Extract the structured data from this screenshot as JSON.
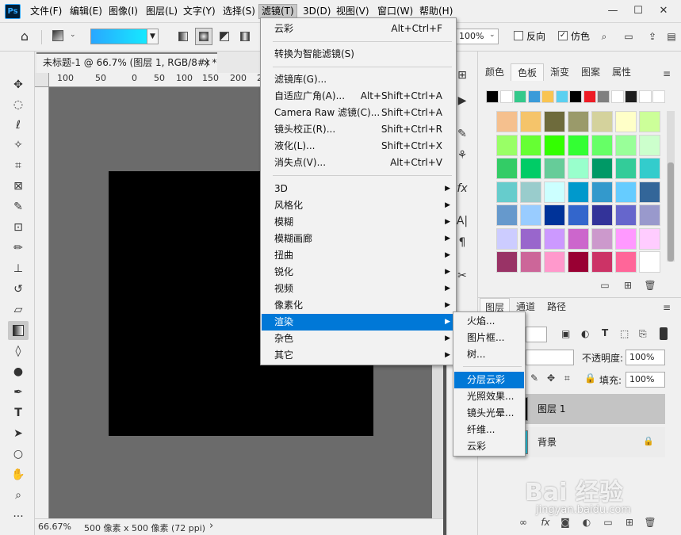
{
  "app": {
    "logo_text": "Ps",
    "menus": [
      "文件(F)",
      "编辑(E)",
      "图像(I)",
      "图层(L)",
      "文字(Y)",
      "选择(S)",
      "滤镜(T)",
      "3D(D)",
      "视图(V)",
      "窗口(W)",
      "帮助(H)"
    ],
    "window_controls": {
      "minimize": "—",
      "maximize": "☐",
      "close": "✕"
    }
  },
  "options_bar": {
    "opacity_value": "100%",
    "reverse_label": "反向",
    "reverse_checked": false,
    "dither_label": "仿色",
    "dither_checked": true,
    "gradient_colors": [
      "#29a7ff",
      "#16e9ff"
    ]
  },
  "document": {
    "tab_title": "未标题-1 @ 66.7% (图层 1, RGB/8#) *",
    "tab_close": "×",
    "ruler_ticks": [
      "100",
      "50",
      "0",
      "50",
      "100",
      "150",
      "200",
      "250"
    ],
    "zoom": "66.67%",
    "status_info": "500 像素 x 500 像素 (72 ppi)",
    "status_arrow": "›"
  },
  "filter_menu": {
    "items": [
      {
        "label": "云彩",
        "shortcut": "Alt+Ctrl+F"
      },
      {
        "label": "转换为智能滤镜(S)",
        "shortcut": ""
      },
      {
        "label": "滤镜库(G)...",
        "shortcut": ""
      },
      {
        "label": "自适应广角(A)...",
        "shortcut": "Alt+Shift+Ctrl+A"
      },
      {
        "label": "Camera Raw 滤镜(C)...",
        "shortcut": "Shift+Ctrl+A"
      },
      {
        "label": "镜头校正(R)...",
        "shortcut": "Shift+Ctrl+R"
      },
      {
        "label": "液化(L)...",
        "shortcut": "Shift+Ctrl+X"
      },
      {
        "label": "消失点(V)...",
        "shortcut": "Alt+Ctrl+V"
      },
      {
        "label": "3D",
        "shortcut": ""
      },
      {
        "label": "风格化",
        "shortcut": ""
      },
      {
        "label": "模糊",
        "shortcut": ""
      },
      {
        "label": "模糊画廊",
        "shortcut": ""
      },
      {
        "label": "扭曲",
        "shortcut": ""
      },
      {
        "label": "锐化",
        "shortcut": ""
      },
      {
        "label": "视频",
        "shortcut": ""
      },
      {
        "label": "像素化",
        "shortcut": ""
      },
      {
        "label": "渲染",
        "shortcut": ""
      },
      {
        "label": "杂色",
        "shortcut": ""
      },
      {
        "label": "其它",
        "shortcut": ""
      }
    ],
    "submenu_arrow": "▶"
  },
  "render_submenu": {
    "items": [
      "火焰...",
      "图片框...",
      "树...",
      "分层云彩",
      "光照效果...",
      "镜头光晕...",
      "纤维...",
      "云彩"
    ]
  },
  "swatches_panel": {
    "tabs": [
      "颜色",
      "色板",
      "渐变",
      "图案",
      "属性"
    ],
    "top_colors": [
      "#000000",
      "#ffffff",
      "#34c98b",
      "#3a9bd9",
      "#f9c452",
      "#5bd0f0",
      "#000000",
      "#ee1c25",
      "#808080",
      "#ffffff",
      "#1e1e1e",
      "#ffffff",
      "#ffffff"
    ],
    "grid_colors": [
      [
        "#f5c08e",
        "#f5c46a",
        "#6e6b3c",
        "#9a9a6a",
        "#d4d29c",
        "#ffffc8",
        "#ccff99"
      ],
      [
        "#99ff66",
        "#66ff33",
        "#33ff00",
        "#33ff33",
        "#66ff66",
        "#99ff99",
        "#ccffcc"
      ],
      [
        "#33cc66",
        "#00cc66",
        "#66cc99",
        "#99ffcc",
        "#009966",
        "#33cc99",
        "#33cccc"
      ],
      [
        "#66cccc",
        "#99cccc",
        "#ccffff",
        "#0099cc",
        "#3399cc",
        "#66ccff",
        "#336699"
      ],
      [
        "#6699cc",
        "#99ccff",
        "#003399",
        "#3366cc",
        "#333399",
        "#6666cc",
        "#9999cc"
      ],
      [
        "#ccccff",
        "#9966cc",
        "#cc99ff",
        "#cc66cc",
        "#cc99cc",
        "#ff99ff",
        "#ffccff"
      ],
      [
        "#993366",
        "#cc6699",
        "#ff99cc",
        "#990033",
        "#cc3366",
        "#ff6699",
        "#ffffff"
      ]
    ]
  },
  "layers_panel": {
    "tabs": [
      "图层",
      "通道",
      "路径"
    ],
    "opacity_label": "不透明度:",
    "opacity_value": "100%",
    "fill_label": "填充:",
    "fill_value": "100%",
    "layers": [
      {
        "name": "图层 1",
        "selected": true,
        "thumb": "#000000"
      },
      {
        "name": "背景",
        "selected": false,
        "thumb": "#2ad3ef"
      }
    ]
  },
  "watermark": {
    "brand": "Bai 经验",
    "url": "jingyan.baidu.com"
  }
}
